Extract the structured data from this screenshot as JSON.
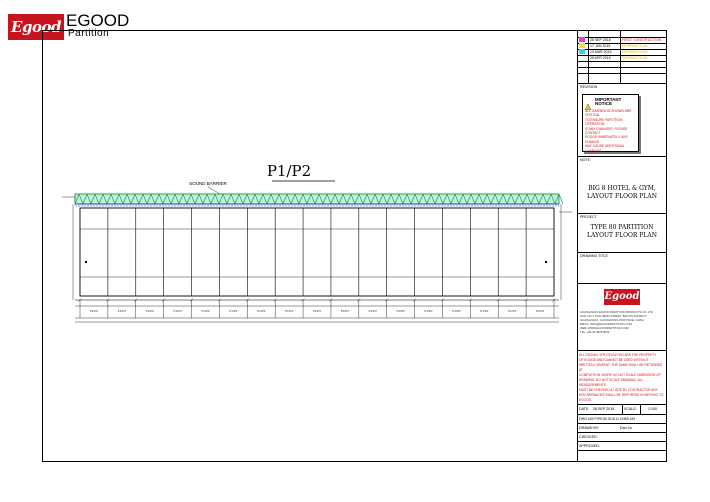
{
  "header": {
    "logo_mark": "Egood",
    "brand": "EGOOD",
    "sub": "Partition"
  },
  "drawing": {
    "title": "P1/P2",
    "sound_barrier_label": "SOUND BARRIER"
  },
  "revisions": {
    "rows": [
      {
        "date": "28 SEP 2018",
        "note": "FIRST CONSTRUCTION"
      },
      {
        "date": "17 JAN 2019",
        "note": "REVISED PLAN"
      },
      {
        "date": "10 MAR 2019",
        "note": "REVISED PLAN"
      },
      {
        "date": "28 APR 2019",
        "note": "REVISED PLAN"
      }
    ]
  },
  "titleblock": {
    "revision_label": "REVISION",
    "important_notice_title": "IMPORTANT NOTICE",
    "notice_text": "ALL DIMENSION SHOWN ARE CRITICAL\nTO ENSURE PARTITION OPERATION,\nIF ANY CHANGES, PLEASE CONTACT\nEGOOD IMMEDIATELY, ANY CHANGE\nMAY CAUSE ADDITIONAL CHARGES",
    "note_label": "NOTE",
    "client_title": "BIG 8 HOTEL & GYM,\nLAYOUT FLOOR PLAN",
    "project_label": "PROJECT",
    "project_title": "TYPE 80 PARTITION\nLAYOUT FLOOR PLAN",
    "drawing_title_label": "DRAWING TITLE",
    "logo_text": "Egood",
    "company_text": "GUANGZHOU EGOOD PARTITION PRODUCTS CO.,LTD\nADD: NO.7 JIAN HENG STREET, BAIYUN DISTRICT\nGUANGZHOU, GUANGDONG PROVINCE, CHINA\nEMAIL: INFO@EGOODPARTITION.COM\nWEB: WWW.EGOODPARTITION.COM\nTEL: +86 20 3625 8000",
    "copyright_text": "ALL DESIGN, SPECIFICATION ARE THE PROPERTY\nOF EGOOD AND CANNOT BE USED WITHOUT\nWRITTEN CONSENT. THE SAME SHALL BE RETURNED AT\nCOMPLETION. WORK DO NOT SCALE DIMENSION OF\nDRAWING. DO NOT SCALE DRAWING. ALL MEASUREMENTS\nMUST BE CHECKED AT SITE BY CONTRACTOR ANY\nDISCREPANCIES SHALL BE REPORTED IN WRITING TO\nEGOOD.",
    "date_label": "DATE:",
    "date_value": "28 SEP 2018",
    "scale_label": "SCALE:",
    "scale_value": "1:100",
    "dwg_no_label": "DRG NO:",
    "dwg_no_value": "TYPE 80 2018 11 CHIMI 433",
    "drawn_by_label": "DRAWN BY:",
    "drawn_by_value": "Dan Xu",
    "checked_label": "CHECKED:",
    "approved_label": "APPROVED:"
  }
}
